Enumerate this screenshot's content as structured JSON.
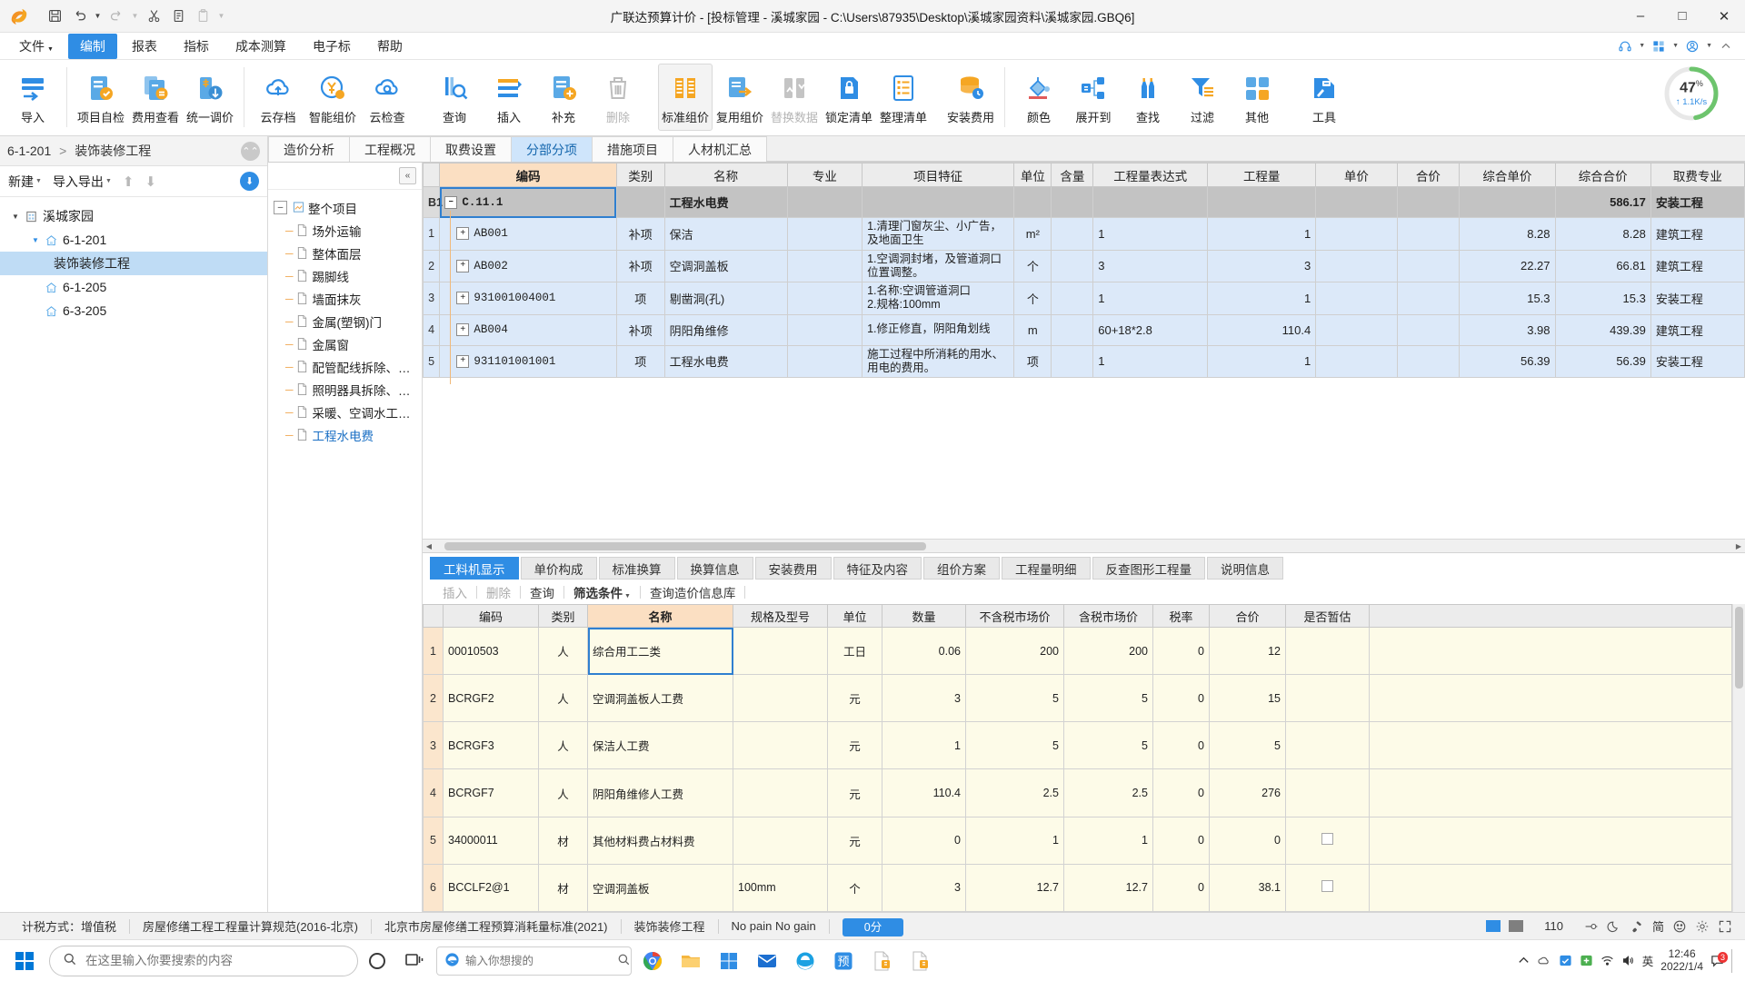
{
  "window": {
    "title": "广联达预算计价 - [投标管理 - 溪城家园 - C:\\Users\\87935\\Desktop\\溪城家园资料\\溪城家园.GBQ6]",
    "minimize": "–",
    "maximize": "□",
    "close": "✕"
  },
  "quick_access": [
    "save-icon",
    "undo-icon",
    "redo-icon",
    "cut-icon",
    "copy-icon",
    "paste-icon"
  ],
  "menu": {
    "items": [
      {
        "label": "文件",
        "caret": true,
        "active": false
      },
      {
        "label": "编制",
        "caret": false,
        "active": true
      },
      {
        "label": "报表",
        "caret": false,
        "active": false
      },
      {
        "label": "指标",
        "caret": false,
        "active": false
      },
      {
        "label": "成本测算",
        "caret": false,
        "active": false
      },
      {
        "label": "电子标",
        "caret": false,
        "active": false
      },
      {
        "label": "帮助",
        "caret": false,
        "active": false
      }
    ]
  },
  "ribbon": {
    "groups": [
      {
        "buttons": [
          {
            "label": "导入",
            "icon": "import-icon",
            "disabled": false,
            "selected": false
          }
        ]
      },
      {
        "buttons": [
          {
            "label": "项目自检",
            "icon": "self-check-icon",
            "disabled": false,
            "selected": false
          },
          {
            "label": "费用查看",
            "icon": "fee-view-icon",
            "disabled": false,
            "selected": false
          },
          {
            "label": "统一调价",
            "icon": "unify-price-icon",
            "disabled": false,
            "selected": false
          }
        ]
      },
      {
        "buttons": [
          {
            "label": "云存档",
            "icon": "cloud-archive-icon",
            "disabled": false,
            "selected": false
          },
          {
            "label": "智能组价",
            "icon": "smart-price-icon",
            "disabled": false,
            "selected": false
          },
          {
            "label": "云检查",
            "icon": "cloud-check-icon",
            "disabled": false,
            "selected": false
          }
        ]
      },
      {
        "buttons": [
          {
            "label": "查询",
            "icon": "query-icon",
            "disabled": false,
            "selected": false
          },
          {
            "label": "插入",
            "icon": "insert-icon",
            "disabled": false,
            "selected": false
          },
          {
            "label": "补充",
            "icon": "supplement-icon",
            "disabled": false,
            "selected": false
          },
          {
            "label": "删除",
            "icon": "delete-icon",
            "disabled": true,
            "selected": false
          }
        ]
      },
      {
        "buttons": [
          {
            "label": "标准组价",
            "icon": "standard-price-icon",
            "disabled": false,
            "selected": true
          },
          {
            "label": "复用组价",
            "icon": "reuse-price-icon",
            "disabled": false,
            "selected": false
          },
          {
            "label": "替换数据",
            "icon": "replace-data-icon",
            "disabled": true,
            "selected": false
          },
          {
            "label": "锁定清单",
            "icon": "lock-list-icon",
            "disabled": false,
            "selected": false
          },
          {
            "label": "整理清单",
            "icon": "organize-list-icon",
            "disabled": false,
            "selected": false
          }
        ]
      },
      {
        "buttons": [
          {
            "label": "安装费用",
            "icon": "install-fee-icon",
            "disabled": false,
            "selected": false
          }
        ]
      },
      {
        "buttons": [
          {
            "label": "颜色",
            "icon": "color-icon",
            "disabled": false,
            "selected": false
          },
          {
            "label": "展开到",
            "icon": "expand-to-icon",
            "disabled": false,
            "selected": false
          },
          {
            "label": "查找",
            "icon": "find-icon",
            "disabled": false,
            "selected": false
          },
          {
            "label": "过滤",
            "icon": "filter-icon",
            "disabled": false,
            "selected": false
          },
          {
            "label": "其他",
            "icon": "other-icon",
            "disabled": false,
            "selected": false
          }
        ]
      },
      {
        "buttons": [
          {
            "label": "工具",
            "icon": "tools-icon",
            "disabled": false,
            "selected": false
          }
        ]
      }
    ],
    "gauge": {
      "percent": "47",
      "unit": "%",
      "rate": "↑ 1.1K/s",
      "color": "#6dc46d"
    }
  },
  "left_panel": {
    "breadcrumb": {
      "code": "6-1-201",
      "sep": ">",
      "name": "装饰装修工程"
    },
    "toolbar": {
      "new": "新建",
      "import_export": "导入导出",
      "up": "↑",
      "down": "↓",
      "download": "⬇"
    },
    "tree": [
      {
        "label": "溪城家园",
        "level": 0,
        "icon": "building-icon",
        "twisty": "▼",
        "selected": false
      },
      {
        "label": "6-1-201",
        "level": 1,
        "icon": "home-icon",
        "twisty": "▼",
        "selected": false
      },
      {
        "label": "装饰装修工程",
        "level": 2,
        "icon": "none",
        "twisty": "",
        "selected": true
      },
      {
        "label": "6-1-205",
        "level": 1,
        "icon": "home-icon",
        "twisty": "",
        "selected": false
      },
      {
        "label": "6-3-205",
        "level": 1,
        "icon": "home-icon",
        "twisty": "",
        "selected": false
      }
    ]
  },
  "main_tabs": [
    {
      "label": "造价分析",
      "active": false
    },
    {
      "label": "工程概况",
      "active": false
    },
    {
      "label": "取费设置",
      "active": false
    },
    {
      "label": "分部分项",
      "active": true
    },
    {
      "label": "措施项目",
      "active": false
    },
    {
      "label": "人材机汇总",
      "active": false
    }
  ],
  "sub_tree": {
    "collapse_button": "«",
    "items": [
      {
        "label": "整个项目",
        "root": true,
        "expander": "–",
        "link": false
      },
      {
        "label": "场外运输",
        "root": false,
        "expander": "",
        "link": false
      },
      {
        "label": "整体面层",
        "root": false,
        "expander": "",
        "link": false
      },
      {
        "label": "踢脚线",
        "root": false,
        "expander": "",
        "link": false
      },
      {
        "label": "墙面抹灰",
        "root": false,
        "expander": "",
        "link": false
      },
      {
        "label": "金属(塑钢)门",
        "root": false,
        "expander": "",
        "link": false
      },
      {
        "label": "金属窗",
        "root": false,
        "expander": "",
        "link": false
      },
      {
        "label": "配管配线拆除、…",
        "root": false,
        "expander": "",
        "link": false
      },
      {
        "label": "照明器具拆除、…",
        "root": false,
        "expander": "",
        "link": false
      },
      {
        "label": "采暖、空调水工…",
        "root": false,
        "expander": "",
        "link": false
      },
      {
        "label": "工程水电费",
        "root": false,
        "expander": "",
        "link": true
      }
    ]
  },
  "top_grid": {
    "columns": [
      "",
      "编码",
      "类别",
      "名称",
      "专业",
      "项目特征",
      "单位",
      "含量",
      "工程量表达式",
      "工程量",
      "单价",
      "合价",
      "综合单价",
      "综合合价",
      "取费专业"
    ],
    "highlight_column": "编码",
    "rows": [
      {
        "kind": "group",
        "idx": "B1",
        "code": "C.11.1",
        "expander": "–",
        "level": 0,
        "category": "",
        "name": "工程水电费",
        "specialty": "",
        "feature": "",
        "unit": "",
        "content": "",
        "expr": "",
        "qty": "",
        "price": "",
        "total": "",
        "comp_price": "",
        "comp_total": "586.17",
        "fee_specialty": "安装工程"
      },
      {
        "kind": "item",
        "idx": "1",
        "code": "AB001",
        "expander": "+",
        "level": 1,
        "category": "补项",
        "name": "保洁",
        "specialty": "",
        "feature": "1.清理门窗灰尘、小广告，及地面卫生",
        "unit": "m²",
        "content": "",
        "expr": "1",
        "qty": "1",
        "price": "",
        "total": "",
        "comp_price": "8.28",
        "comp_total": "8.28",
        "fee_specialty": "建筑工程"
      },
      {
        "kind": "item",
        "idx": "2",
        "code": "AB002",
        "expander": "+",
        "level": 1,
        "category": "补项",
        "name": "空调洞盖板",
        "specialty": "",
        "feature": "1.空调洞封堵，及管道洞口位置调整。",
        "unit": "个",
        "content": "",
        "expr": "3",
        "qty": "3",
        "price": "",
        "total": "",
        "comp_price": "22.27",
        "comp_total": "66.81",
        "fee_specialty": "建筑工程"
      },
      {
        "kind": "item",
        "idx": "3",
        "code": "931001004001",
        "expander": "+",
        "level": 1,
        "category": "项",
        "name": "剔凿洞(孔)",
        "specialty": "",
        "feature": "1.名称:空调管道洞口\n2.规格:100mm",
        "unit": "个",
        "content": "",
        "expr": "1",
        "qty": "1",
        "price": "",
        "total": "",
        "comp_price": "15.3",
        "comp_total": "15.3",
        "fee_specialty": "安装工程"
      },
      {
        "kind": "item",
        "idx": "4",
        "code": "AB004",
        "expander": "+",
        "level": 1,
        "category": "补项",
        "name": "阴阳角维修",
        "specialty": "",
        "feature": "1.修正修直，阴阳角划线",
        "unit": "m",
        "content": "",
        "expr": "60+18*2.8",
        "qty": "110.4",
        "price": "",
        "total": "",
        "comp_price": "3.98",
        "comp_total": "439.39",
        "fee_specialty": "建筑工程"
      },
      {
        "kind": "item",
        "idx": "5",
        "code": "931101001001",
        "expander": "+",
        "level": 1,
        "category": "项",
        "name": "工程水电费",
        "specialty": "",
        "feature": "施工过程中所消耗的用水、用电的费用。",
        "unit": "项",
        "content": "",
        "expr": "1",
        "qty": "1",
        "price": "",
        "total": "",
        "comp_price": "56.39",
        "comp_total": "56.39",
        "fee_specialty": "安装工程"
      }
    ]
  },
  "bottom_panel": {
    "tabs": [
      {
        "label": "工料机显示",
        "active": true
      },
      {
        "label": "单价构成",
        "active": false
      },
      {
        "label": "标准换算",
        "active": false
      },
      {
        "label": "换算信息",
        "active": false
      },
      {
        "label": "安装费用",
        "active": false
      },
      {
        "label": "特征及内容",
        "active": false
      },
      {
        "label": "组价方案",
        "active": false
      },
      {
        "label": "工程量明细",
        "active": false
      },
      {
        "label": "反查图形工程量",
        "active": false
      },
      {
        "label": "说明信息",
        "active": false
      }
    ],
    "actions": [
      {
        "label": "插入",
        "disabled": true,
        "bold": false,
        "caret": false
      },
      {
        "label": "删除",
        "disabled": true,
        "bold": false,
        "caret": false
      },
      {
        "label": "查询",
        "disabled": false,
        "bold": false,
        "caret": false
      },
      {
        "label": "筛选条件",
        "disabled": false,
        "bold": true,
        "caret": true
      },
      {
        "label": "查询造价信息库",
        "disabled": false,
        "bold": false,
        "caret": false
      }
    ],
    "columns": [
      "",
      "编码",
      "类别",
      "名称",
      "规格及型号",
      "单位",
      "数量",
      "不含税市场价",
      "含税市场价",
      "税率",
      "合价",
      "是否暂估"
    ],
    "highlight_column": "名称",
    "rows": [
      {
        "idx": "1",
        "code": "00010503",
        "category": "人",
        "name": "综合用工二类",
        "spec": "",
        "unit": "工日",
        "qty": "0.06",
        "price_ex": "200",
        "price_in": "200",
        "tax": "0",
        "total": "12",
        "estimate": false,
        "selected": true
      },
      {
        "idx": "2",
        "code": "BCRGF2",
        "category": "人",
        "name": "空调洞盖板人工费",
        "spec": "",
        "unit": "元",
        "qty": "3",
        "price_ex": "5",
        "price_in": "5",
        "tax": "0",
        "total": "15",
        "estimate": false,
        "selected": false
      },
      {
        "idx": "3",
        "code": "BCRGF3",
        "category": "人",
        "name": "保洁人工费",
        "spec": "",
        "unit": "元",
        "qty": "1",
        "price_ex": "5",
        "price_in": "5",
        "tax": "0",
        "total": "5",
        "estimate": false,
        "selected": false
      },
      {
        "idx": "4",
        "code": "BCRGF7",
        "category": "人",
        "name": "阴阳角维修人工费",
        "spec": "",
        "unit": "元",
        "qty": "110.4",
        "price_ex": "2.5",
        "price_in": "2.5",
        "tax": "0",
        "total": "276",
        "estimate": false,
        "selected": false
      },
      {
        "idx": "5",
        "code": "34000011",
        "category": "材",
        "name": "其他材料费占材料费",
        "spec": "",
        "unit": "元",
        "qty": "0",
        "price_ex": "1",
        "price_in": "1",
        "tax": "0",
        "total": "0",
        "estimate": true,
        "selected": false
      },
      {
        "idx": "6",
        "code": "BCCLF2@1",
        "category": "材",
        "name": "空调洞盖板",
        "spec": "100mm",
        "unit": "个",
        "qty": "3",
        "price_ex": "12.7",
        "price_in": "12.7",
        "tax": "0",
        "total": "38.1",
        "estimate": true,
        "selected": false
      }
    ]
  },
  "status_bar": {
    "tax_label": "计税方式：增值税",
    "standard": "房屋修缮工程工程量计算规范(2016-北京)",
    "quota": "北京市房屋修缮工程预算消耗量标准(2021)",
    "project": "装饰装修工程",
    "slogan": "No pain No gain",
    "score": "0分",
    "zoom": "110",
    "lang": "简"
  },
  "taskbar": {
    "search_placeholder": "在这里输入你要搜索的内容",
    "edge_placeholder": "输入你想搜的",
    "clock_time": "12:46",
    "clock_date": "2022/1/4",
    "ime": "英",
    "tray_badge": "3",
    "apps": [
      {
        "name": "cortana-icon"
      },
      {
        "name": "task-view-icon"
      },
      {
        "name": "edge-search-icon"
      },
      {
        "name": "chrome-icon"
      },
      {
        "name": "file-explorer-icon"
      },
      {
        "name": "store-icon"
      },
      {
        "name": "mail-icon"
      },
      {
        "name": "ie-icon"
      },
      {
        "name": "gld-budget-icon"
      },
      {
        "name": "gld-doc1-icon"
      },
      {
        "name": "gld-doc2-icon"
      }
    ]
  }
}
